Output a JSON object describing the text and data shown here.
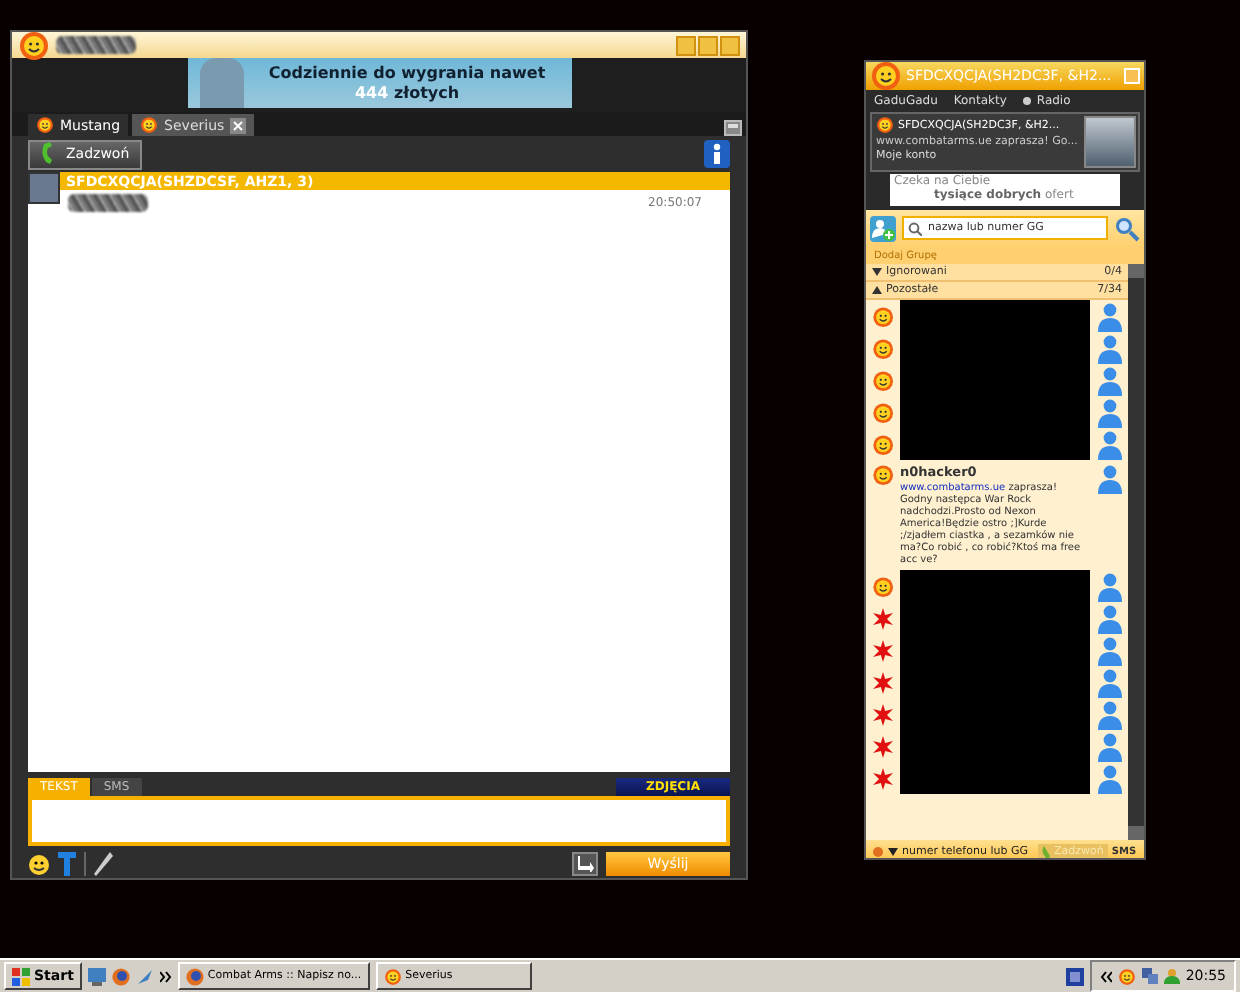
{
  "chat_window": {
    "banner": {
      "line_1": "Codziennie do wygrania nawet",
      "amount": "444",
      "line_2": "złotych"
    },
    "tabs": [
      {
        "label": "Mustang",
        "selected": true,
        "closable": false
      },
      {
        "label": "Severius",
        "selected": false,
        "closable": true
      }
    ],
    "call_button": "Zadzwoń",
    "message": {
      "sender": "SFDCXQCJA(SHZDCSF, AHZ1, 3)",
      "time": "20:50:07"
    },
    "input_tabs": [
      {
        "label": "TEKST",
        "selected": true
      },
      {
        "label": "SMS",
        "selected": false
      }
    ],
    "photos_button": "ZDJĘCIA",
    "send_button": "Wyślij"
  },
  "contacts_window": {
    "title": "SFDCXQCJA(SH2DC3F, &H2...",
    "menu": [
      "GaduGadu",
      "Kontakty",
      "Radio"
    ],
    "profile": {
      "name": "SFDCXQCJA(SH2DC3F, &H2...",
      "status": "www.combatarms.ue zaprasza! Go...",
      "account_link": "Moje konto"
    },
    "ad": {
      "line_1": "Czeka na Ciebie",
      "line_2_bold": "tysiące dobrych",
      "line_2_rest": "ofert"
    },
    "search": {
      "placeholder": "nazwa lub numer GG"
    },
    "add_group": "Dodaj Grupę",
    "groups": [
      {
        "name": "Ignorowani",
        "count": "0/4",
        "expanded": false
      },
      {
        "name": "Pozostałe",
        "count": "7/34",
        "expanded": true
      }
    ],
    "contacts": [
      {
        "kind": "redacted",
        "busy": false
      },
      {
        "kind": "redacted",
        "busy": false
      },
      {
        "kind": "redacted",
        "busy": false
      },
      {
        "kind": "redacted",
        "busy": false
      },
      {
        "kind": "redacted",
        "busy": false
      },
      {
        "kind": "contact",
        "busy": false,
        "name": "n0hacker0",
        "link": "www.combatarms.ue",
        "description": "zaprasza! Godny następca War Rock nadchodzi.Prosto od Nexon America!Będzie ostro ;]Kurde ;/zjadłem ciastka , a sezamków nie ma?Co robić , co robić?Ktoś ma free acc ve?"
      },
      {
        "kind": "redacted",
        "busy": false
      },
      {
        "kind": "redacted",
        "busy": true
      },
      {
        "kind": "redacted",
        "busy": true
      },
      {
        "kind": "redacted",
        "busy": true
      },
      {
        "kind": "redacted",
        "busy": true
      },
      {
        "kind": "redacted",
        "busy": true
      },
      {
        "kind": "redacted",
        "busy": true
      }
    ],
    "number_field": {
      "placeholder": "numer telefonu lub GG"
    },
    "call_button": "Zadzwoń",
    "sms_button": "SMS"
  },
  "taskbar": {
    "start": "Start",
    "tasks": [
      {
        "label": "Combat Arms :: Napisz no...",
        "selected": false
      },
      {
        "label": "Severius",
        "selected": false
      }
    ],
    "clock": "20:55"
  }
}
